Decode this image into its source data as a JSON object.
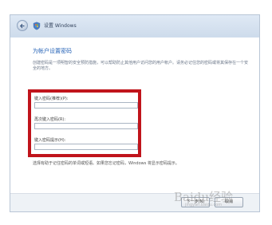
{
  "window": {
    "title": "设置 Windows"
  },
  "page": {
    "heading": "为帐户设置密码",
    "description": "创建密码是一项明智的安全预防措施，可以帮助防止其他用户访问您的用户帐户。请务必记住您的密码或将其保存在一个安全的地方。"
  },
  "fields": [
    {
      "label": "键入密码(推荐)(P):",
      "value": ""
    },
    {
      "label": "再次键入密码(R):",
      "value": ""
    },
    {
      "label": "键入密码提示(H):",
      "value": ""
    }
  ],
  "hint_note": "选择有助于记住密码的单词或短语。如果您忘记密码，Windows 将显示密码提示。",
  "footer": {
    "next_label": "下一步(N)",
    "cancel_label": "取消"
  },
  "watermark": {
    "logo": "Baidu经验",
    "sub": "jingyan.baidu.com"
  },
  "colors": {
    "highlight": "#c0141b",
    "heading": "#2a66b8"
  },
  "icons": {
    "back": "back-arrow-icon",
    "shield": "windows-shield-icon"
  }
}
